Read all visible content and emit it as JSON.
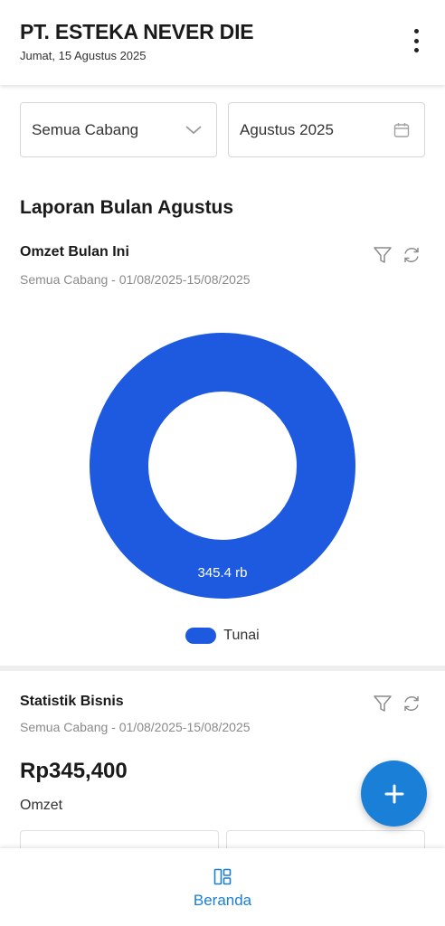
{
  "header": {
    "company": "PT. ESTEKA NEVER DIE",
    "date": "Jumat, 15 Agustus 2025",
    "more_icon": "more-vertical-icon"
  },
  "filters": {
    "branch_value": "Semua Cabang",
    "branch_icon": "chevron-down-icon",
    "month_value": "Agustus 2025",
    "month_icon": "calendar-icon"
  },
  "report": {
    "title": "Laporan Bulan Agustus"
  },
  "omzet_card": {
    "title": "Omzet Bulan Ini",
    "subtitle": "Semua Cabang - 01/08/2025-15/08/2025",
    "filter_icon": "filter-icon",
    "refresh_icon": "refresh-icon"
  },
  "chart_data": {
    "type": "pie",
    "variant": "donut",
    "series": [
      {
        "name": "Tunai",
        "value": 345400,
        "label": "345.4 rb",
        "color": "#1d5ae0"
      }
    ],
    "legend_position": "bottom"
  },
  "stats_card": {
    "title": "Statistik Bisnis",
    "subtitle": "Semua Cabang - 01/08/2025-15/08/2025",
    "value": "Rp345,400",
    "label": "Omzet"
  },
  "fab": {
    "icon": "plus-icon"
  },
  "nav": {
    "items": [
      {
        "label": "Beranda",
        "icon": "dashboard-icon",
        "active": true
      }
    ]
  },
  "colors": {
    "accent": "#1a7fd6",
    "chart_blue": "#1d5ae0"
  }
}
